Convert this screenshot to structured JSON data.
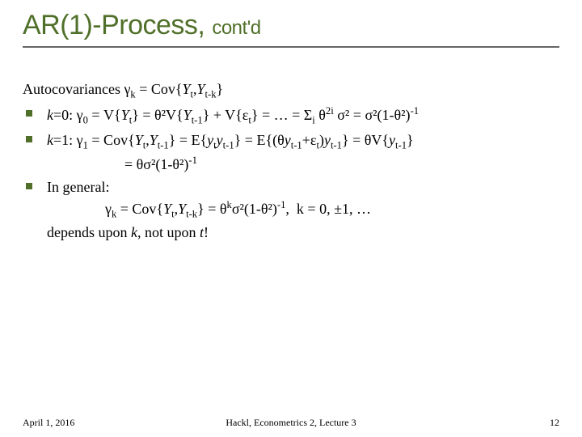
{
  "title": "AR(1)-Process, ",
  "title_contd": "cont'd",
  "intro": "Autocovariances γₖ = Cov{Yₜ,Yₜ₋ₖ}",
  "bullets": {
    "b0": "k=0: γ₀ = V{Yₜ} = θ²V{Yₜ₋₁} + V{εₜ} = … = Σᵢ θ²ⁱ σ² = σ²(1-θ²)⁻¹",
    "b1a": "k=1: γ₁ = Cov{Yₜ,Yₜ₋₁} = E{yₜyₜ₋₁} = E{(θyₜ₋₁+εₜ)yₜ₋₁} = θV{yₜ₋₁}",
    "b1b": "= θσ²(1-θ²)⁻¹",
    "b2a": "In general:",
    "b2b": "γₖ = Cov{Yₜ,Yₜ₋ₖ} = θᵏσ²(1-θ²)⁻¹,  k = 0, ±1, …",
    "b2c": "depends upon k, not upon t!"
  },
  "footer": {
    "date": "April 1, 2016",
    "center": "Hackl, Econometrics 2, Lecture 3",
    "page": "12"
  }
}
